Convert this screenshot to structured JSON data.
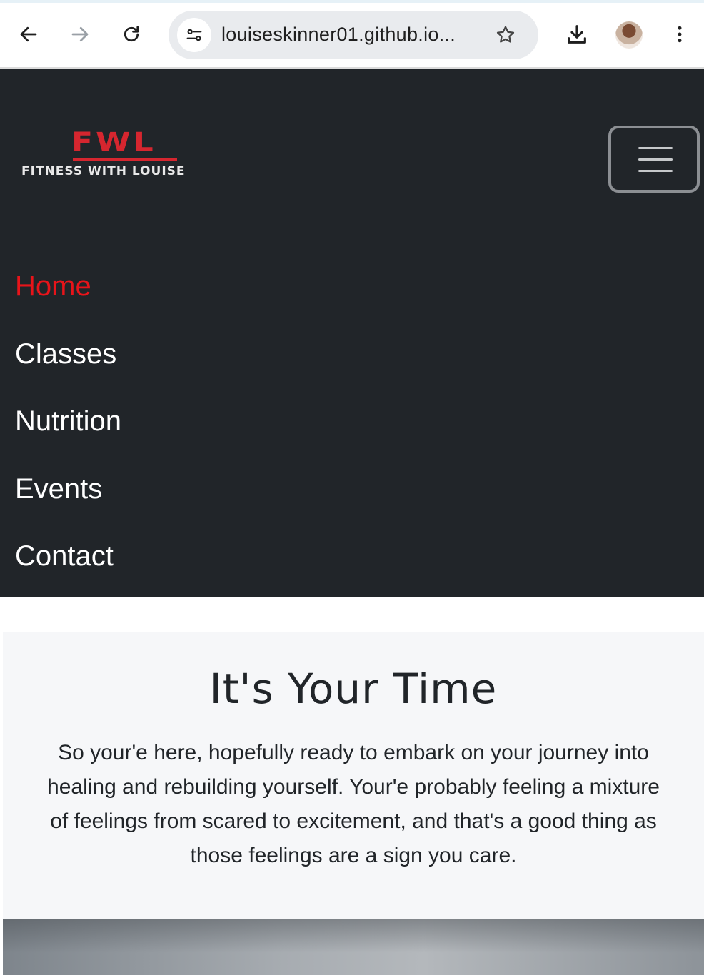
{
  "browser": {
    "url": "louiseskinner01.github.io...",
    "icons": [
      "back-arrow-icon",
      "forward-arrow-icon",
      "reload-icon",
      "site-info-icon",
      "bookmark-star-icon",
      "download-icon",
      "profile-avatar",
      "more-vert-icon"
    ]
  },
  "logo": {
    "mark": "FWL",
    "text": "FITNESS WITH LOUISE",
    "accent_color": "#d6262f"
  },
  "navbar": {
    "background": "#212529",
    "items": [
      {
        "label": "Home",
        "active": true
      },
      {
        "label": "Classes",
        "active": false
      },
      {
        "label": "Nutrition",
        "active": false
      },
      {
        "label": "Events",
        "active": false
      },
      {
        "label": "Contact",
        "active": false
      }
    ],
    "active_color": "#e8141a"
  },
  "hero": {
    "title": "It's Your Time",
    "text": "So your'e here, hopefully ready to embark on your journey into healing and rebuilding yourself. Your'e probably feeling a mixture of feelings from scared to excitement, and that's a good thing as those feelings are a sign you care."
  }
}
